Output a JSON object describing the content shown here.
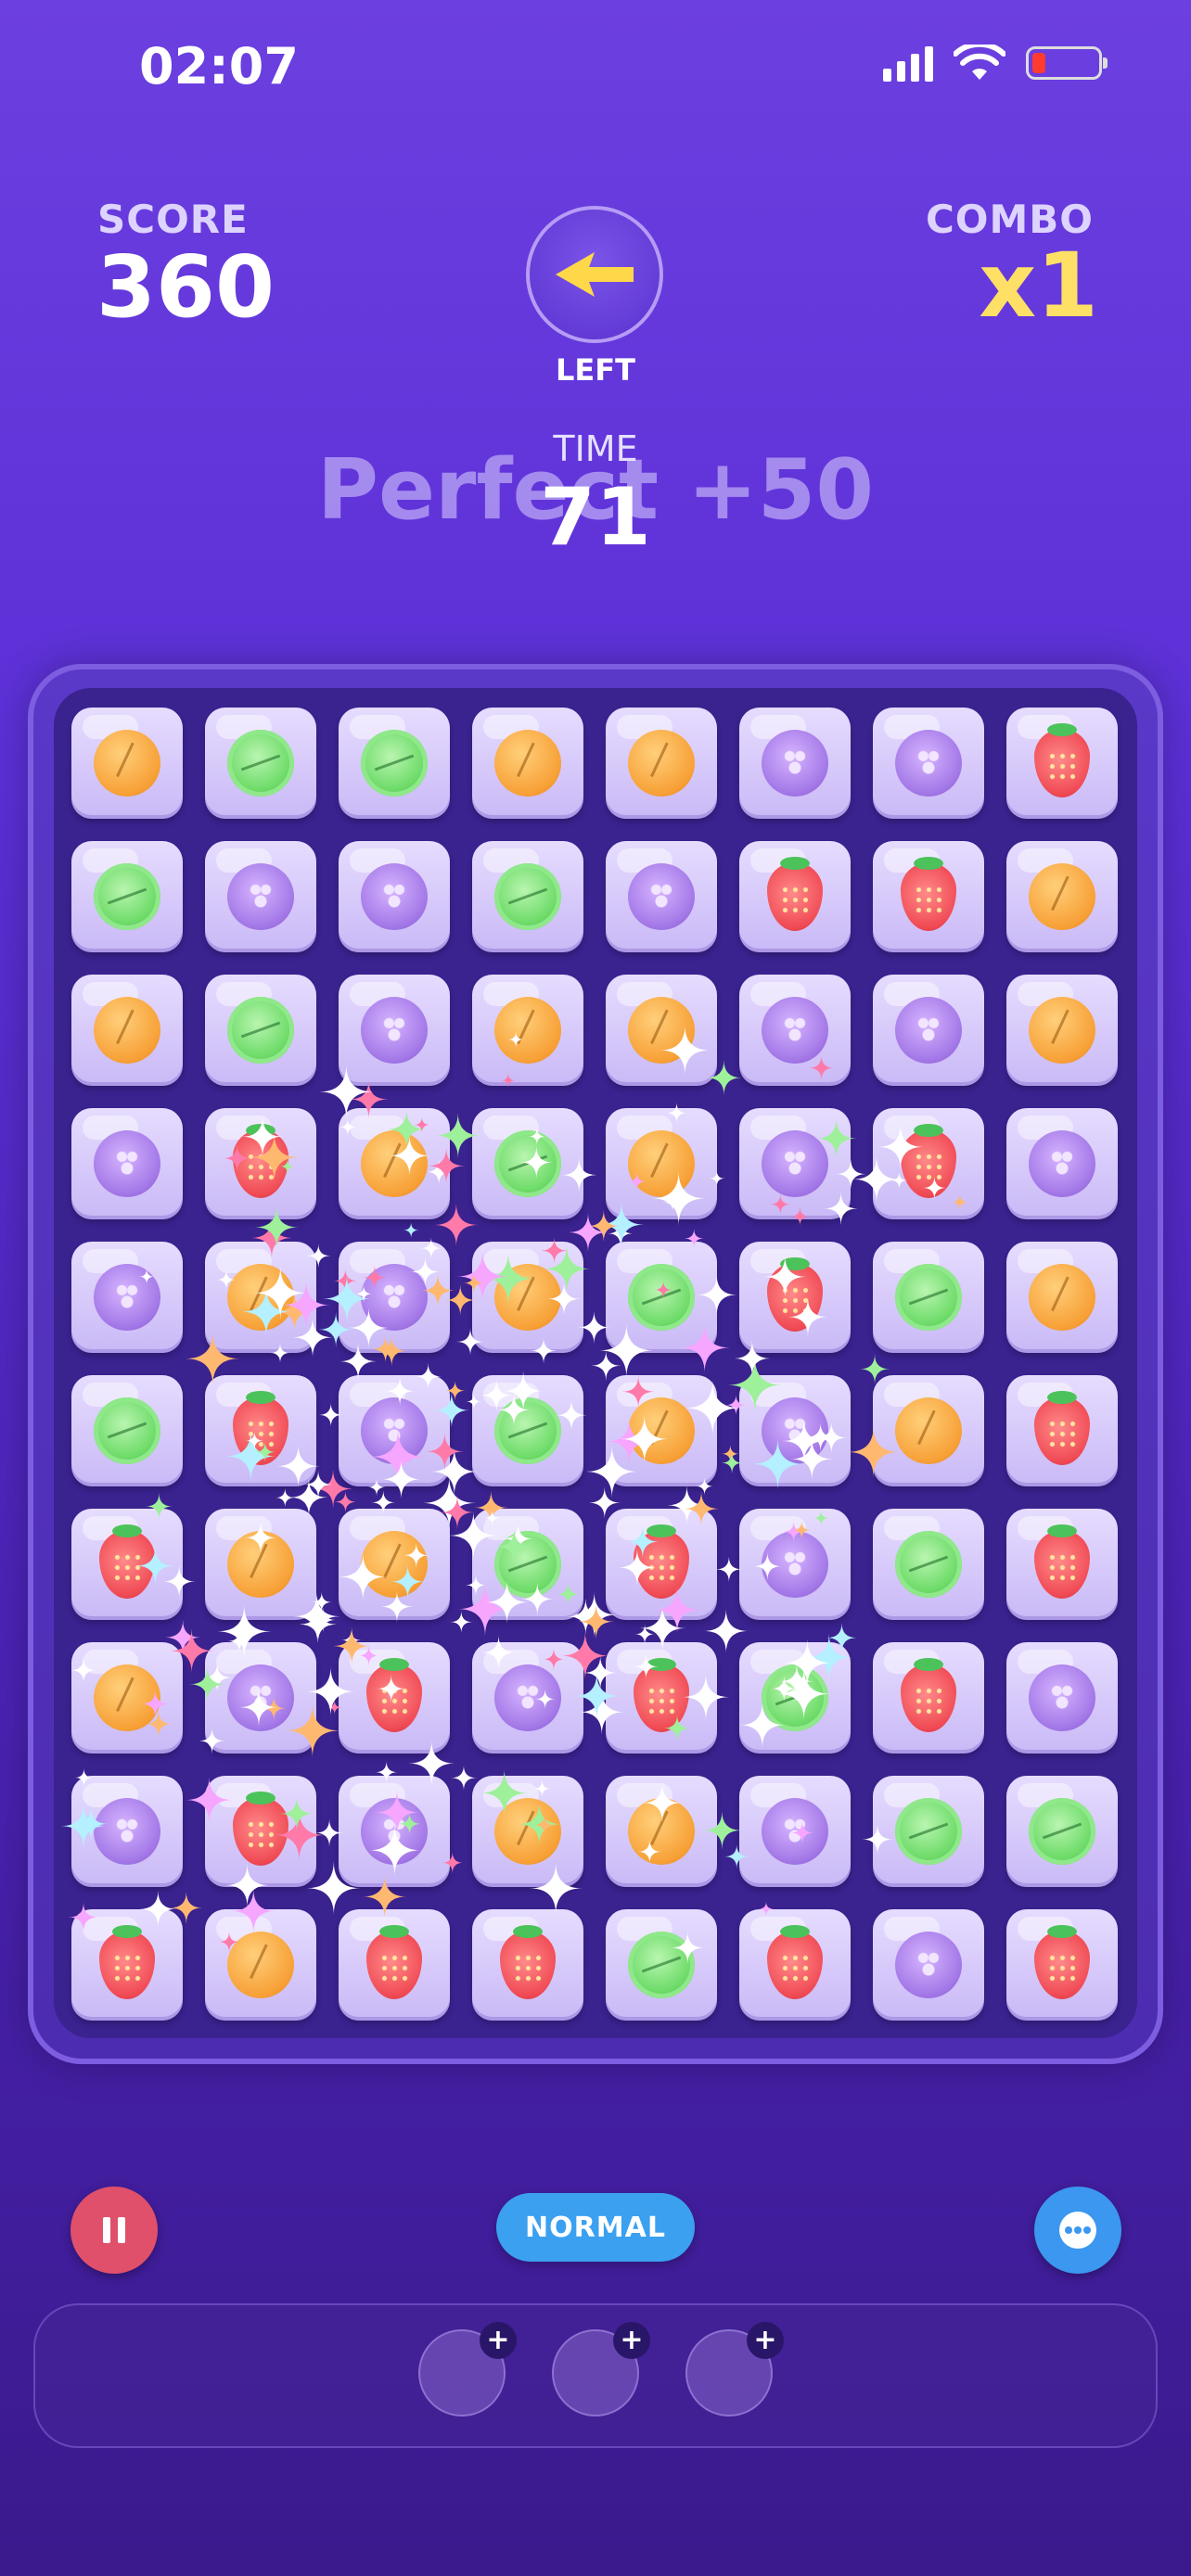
{
  "status_bar": {
    "time": "02:07",
    "battery_level": 0.15
  },
  "header": {
    "score_label": "SCORE",
    "score_value": "360",
    "combo_label": "COMBO",
    "combo_value": "x1",
    "direction_icon": "arrow-left-icon",
    "direction_label": "LEFT",
    "feedback_text": "Perfect +50",
    "time_label": "TIME",
    "time_value": "71"
  },
  "board": {
    "rows": [
      [
        "orange",
        "lime",
        "lime",
        "orange",
        "orange",
        "berry",
        "berry",
        "strawberry"
      ],
      [
        "lime",
        "berry",
        "berry",
        "lime",
        "berry",
        "strawberry",
        "strawberry",
        "orange"
      ],
      [
        "orange",
        "lime",
        "berry",
        "orange",
        "orange",
        "berry",
        "berry",
        "orange"
      ],
      [
        "berry",
        "strawberry",
        "orange",
        "lime",
        "orange",
        "berry",
        "strawberry",
        "berry"
      ],
      [
        "berry",
        "orange",
        "berry",
        "orange",
        "lime",
        "strawberry",
        "lime",
        "orange"
      ],
      [
        "lime",
        "strawberry",
        "berry",
        "lime",
        "orange",
        "berry",
        "orange",
        "strawberry"
      ],
      [
        "strawberry",
        "orange",
        "orange",
        "lime",
        "strawberry",
        "berry",
        "lime",
        "strawberry"
      ],
      [
        "orange",
        "berry",
        "strawberry",
        "berry",
        "strawberry",
        "lime",
        "strawberry",
        "berry"
      ],
      [
        "berry",
        "strawberry",
        "berry",
        "orange",
        "orange",
        "berry",
        "lime",
        "lime"
      ],
      [
        "strawberry",
        "orange",
        "strawberry",
        "strawberry",
        "lime",
        "strawberry",
        "berry",
        "strawberry"
      ]
    ]
  },
  "controls": {
    "pause_icon": "pause-icon",
    "difficulty_label": "NORMAL",
    "menu_icon": "more-icon",
    "slots": [
      "+",
      "+",
      "+"
    ]
  },
  "colors": {
    "accent": "#3ba0f0",
    "combo": "#ffe066",
    "pause": "#e0506a"
  }
}
